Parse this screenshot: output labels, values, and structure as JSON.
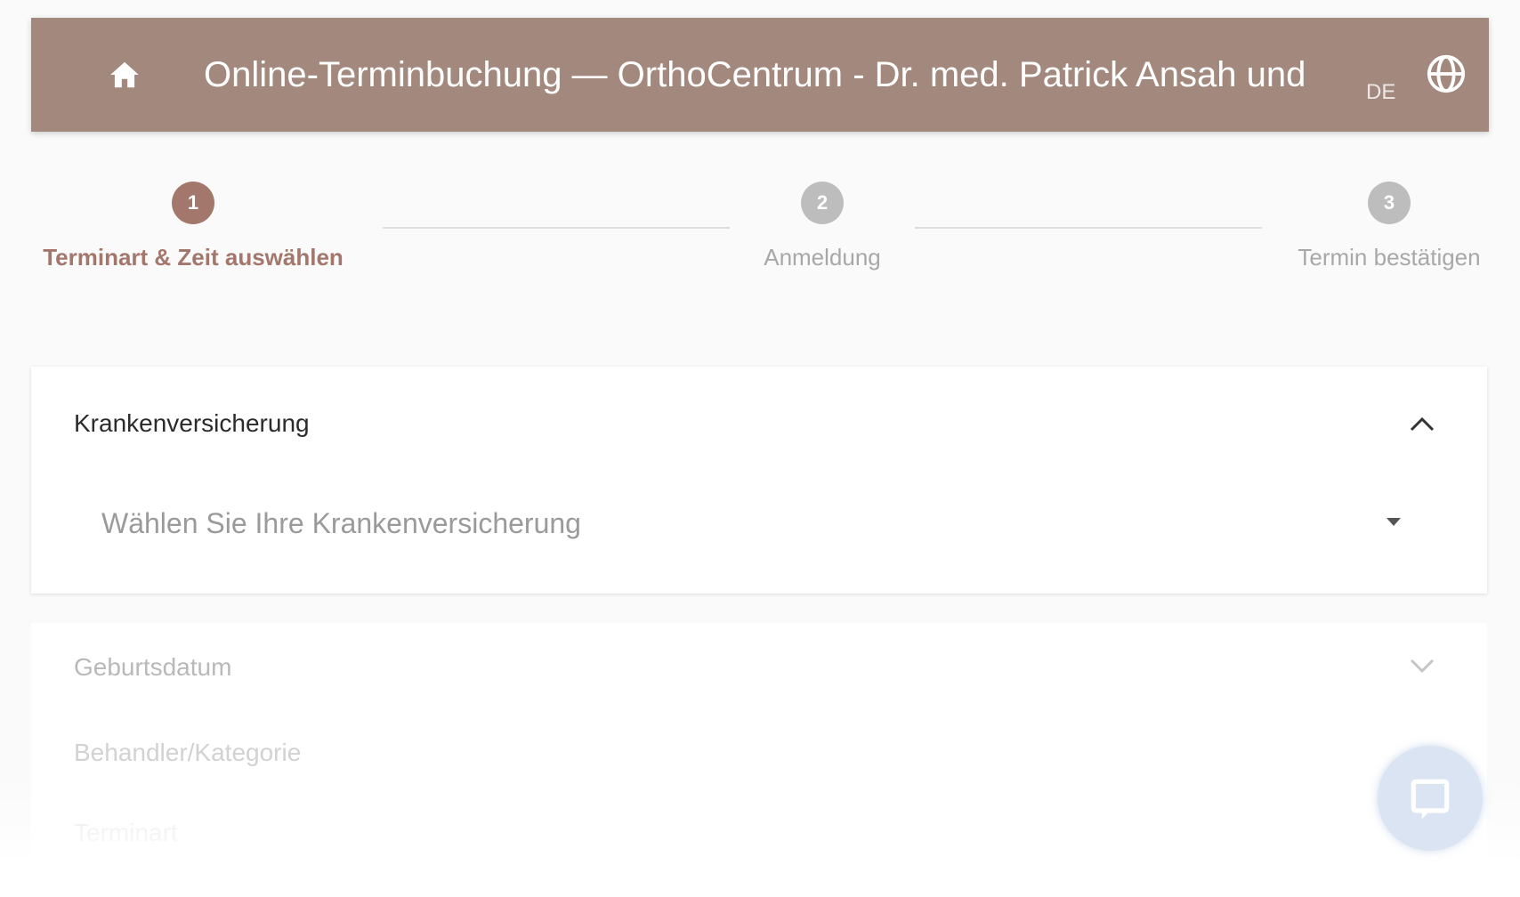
{
  "header": {
    "title": "Online-Terminbuchung — OrthoCentrum - Dr. med. Patrick Ansah und",
    "language": "DE",
    "home_icon": "home-icon",
    "language_icon": "globe-icon",
    "background_color": "#a3887e"
  },
  "stepper": {
    "steps": [
      {
        "number": "1",
        "label": "Terminart & Zeit auswählen",
        "state": "active",
        "color": "#a3776c"
      },
      {
        "number": "2",
        "label": "Anmeldung",
        "state": "inactive",
        "color": "#bdbdbd"
      },
      {
        "number": "3",
        "label": "Termin bestätigen",
        "state": "inactive",
        "color": "#bdbdbd"
      }
    ]
  },
  "insurance": {
    "title": "Krankenversicherung",
    "expanded": true,
    "select_placeholder": "Wählen Sie Ihre Krankenversicherung"
  },
  "sections": [
    {
      "title": "Geburtsdatum"
    },
    {
      "title": "Behandler/Kategorie"
    },
    {
      "title": "Terminart"
    }
  ],
  "chat": {
    "icon": "chat-icon"
  }
}
